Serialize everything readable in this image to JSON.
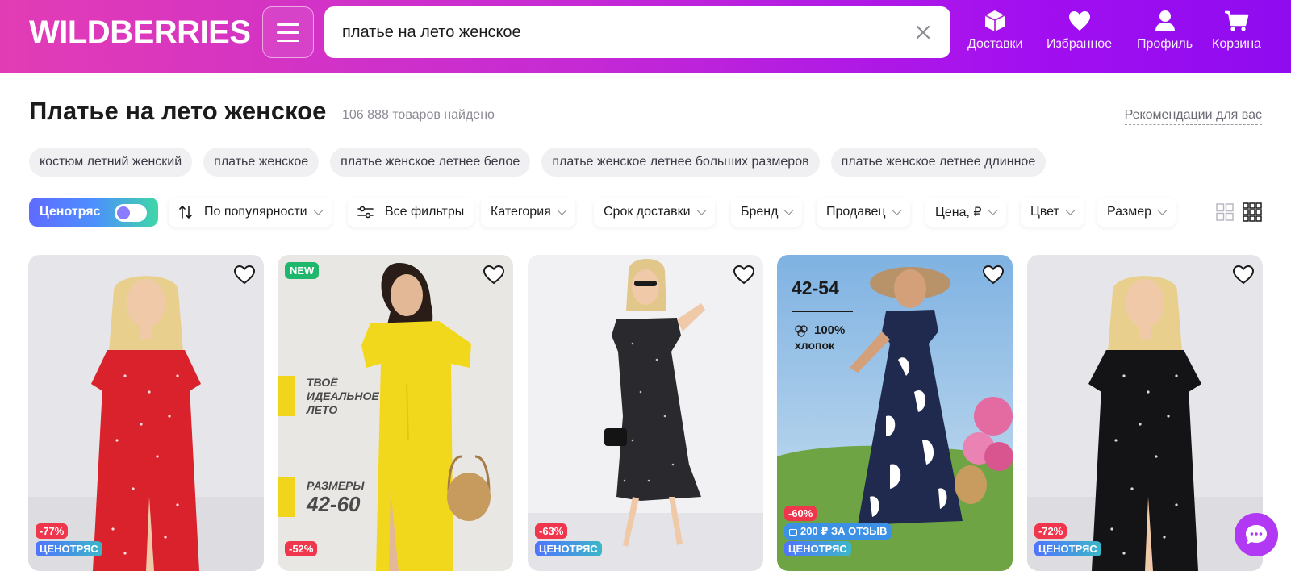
{
  "header": {
    "logo": "WILDBERRIES",
    "search_value": "платье на лето женское",
    "nav": {
      "delivery": "Доставки",
      "favorites": "Избранное",
      "profile": "Профиль",
      "cart": "Корзина"
    }
  },
  "page": {
    "title": "Платье на лето женское",
    "count": "106 888 товаров найдено",
    "recommendations": "Рекомендации для вас"
  },
  "chips": [
    "костюм летний женский",
    "платье женское",
    "платье женское летнее белое",
    "платье женское летнее больших размеров",
    "платье женское летнее длинное"
  ],
  "filters": {
    "price_shake": "Ценотряс",
    "sort": "По популярности",
    "all_filters": "Все фильтры",
    "category": "Категория",
    "delivery_time": "Срок доставки",
    "brand": "Бренд",
    "seller": "Продавец",
    "price": "Цена, ₽",
    "color": "Цвет",
    "size": "Размер"
  },
  "products": [
    {
      "discount": "-77%",
      "tag": "ЦЕНОТРЯС",
      "dress_color": "#d9222c"
    },
    {
      "badge": "NEW",
      "discount": "-52%",
      "promo_line1": "ТВОЁ",
      "promo_line2": "ИДЕАЛЬНОЕ",
      "promo_line3": "ЛЕТО",
      "promo_sizes_label": "РАЗМЕРЫ",
      "promo_sizes": "42-60",
      "dress_color": "#f2d81c"
    },
    {
      "discount": "-63%",
      "tag": "ЦЕНОТРЯС",
      "dress_color": "#2a2a2e"
    },
    {
      "discount": "-60%",
      "review": "200 ₽ ЗА ОТЗЫВ",
      "tag": "ЦЕНОТРЯС",
      "size_range": "42-54",
      "fabric_pct": "100%",
      "fabric": "хлопок",
      "dress_color": "#1f2a4e"
    },
    {
      "discount": "-72%",
      "tag": "ЦЕНОТРЯС",
      "dress_color": "#141416"
    }
  ],
  "colors": {
    "accent": "#cb11ab",
    "discount": "#f0364c",
    "new": "#1fb76b",
    "chat": "#b139f3"
  }
}
